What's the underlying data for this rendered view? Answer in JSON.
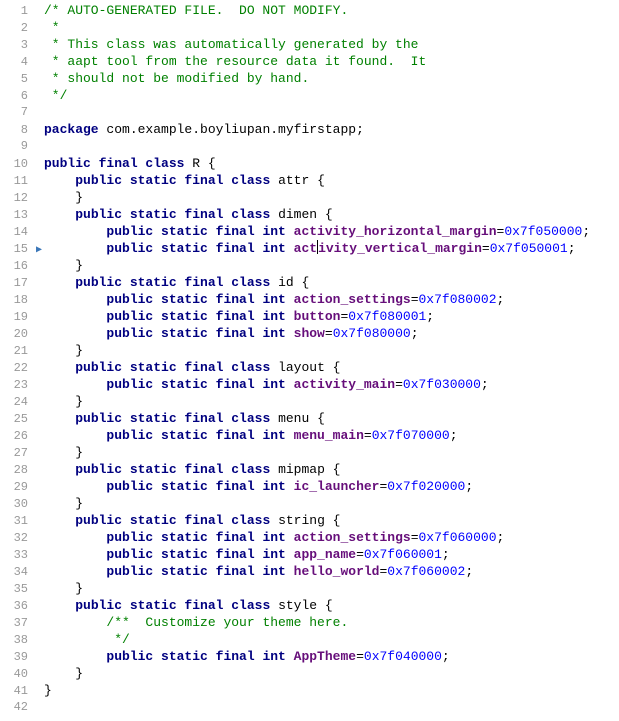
{
  "lines": [
    {
      "n": 1,
      "segs": [
        {
          "cls": "comment",
          "t": "/* AUTO-GENERATED FILE.  DO NOT MODIFY."
        }
      ]
    },
    {
      "n": 2,
      "segs": [
        {
          "cls": "comment",
          "t": " *"
        }
      ]
    },
    {
      "n": 3,
      "segs": [
        {
          "cls": "comment",
          "t": " * This class was automatically generated by the"
        }
      ]
    },
    {
      "n": 4,
      "segs": [
        {
          "cls": "comment",
          "t": " * aapt tool from the resource data it found.  It"
        }
      ]
    },
    {
      "n": 5,
      "segs": [
        {
          "cls": "comment",
          "t": " * should not be modified by hand."
        }
      ]
    },
    {
      "n": 6,
      "segs": [
        {
          "cls": "comment",
          "t": " */"
        }
      ]
    },
    {
      "n": 7,
      "segs": []
    },
    {
      "n": 8,
      "segs": [
        {
          "cls": "keyword",
          "t": "package "
        },
        {
          "cls": "identifier",
          "t": "com.example.boyliupan.myfirstapp"
        },
        {
          "cls": "punct",
          "t": ";"
        }
      ]
    },
    {
      "n": 9,
      "segs": []
    },
    {
      "n": 10,
      "segs": [
        {
          "cls": "keyword",
          "t": "public final class "
        },
        {
          "cls": "identifier",
          "t": "R "
        },
        {
          "cls": "punct",
          "t": "{"
        }
      ]
    },
    {
      "n": 11,
      "segs": [
        {
          "cls": "punct",
          "t": "    "
        },
        {
          "cls": "keyword",
          "t": "public static final class "
        },
        {
          "cls": "identifier",
          "t": "attr "
        },
        {
          "cls": "punct",
          "t": "{"
        }
      ]
    },
    {
      "n": 12,
      "segs": [
        {
          "cls": "punct",
          "t": "    }"
        }
      ]
    },
    {
      "n": 13,
      "segs": [
        {
          "cls": "punct",
          "t": "    "
        },
        {
          "cls": "keyword",
          "t": "public static final class "
        },
        {
          "cls": "identifier",
          "t": "dimen "
        },
        {
          "cls": "punct",
          "t": "{"
        }
      ]
    },
    {
      "n": 14,
      "segs": [
        {
          "cls": "punct",
          "t": "        "
        },
        {
          "cls": "keyword",
          "t": "public static final int "
        },
        {
          "cls": "field",
          "t": "activity_horizontal_margin"
        },
        {
          "cls": "punct",
          "t": "="
        },
        {
          "cls": "number",
          "t": "0x7f050000"
        },
        {
          "cls": "punct",
          "t": ";"
        }
      ]
    },
    {
      "n": 15,
      "marker": "▶",
      "segs": [
        {
          "cls": "punct",
          "t": "        "
        },
        {
          "cls": "keyword",
          "t": "public static final int "
        },
        {
          "cls": "field",
          "t": "act"
        },
        {
          "cls": "caret",
          "t": ""
        },
        {
          "cls": "field",
          "t": "ivity_vertical_margin"
        },
        {
          "cls": "punct",
          "t": "="
        },
        {
          "cls": "number",
          "t": "0x7f050001"
        },
        {
          "cls": "punct",
          "t": ";"
        }
      ]
    },
    {
      "n": 16,
      "segs": [
        {
          "cls": "punct",
          "t": "    }"
        }
      ]
    },
    {
      "n": 17,
      "segs": [
        {
          "cls": "punct",
          "t": "    "
        },
        {
          "cls": "keyword",
          "t": "public static final class "
        },
        {
          "cls": "identifier",
          "t": "id "
        },
        {
          "cls": "punct",
          "t": "{"
        }
      ]
    },
    {
      "n": 18,
      "segs": [
        {
          "cls": "punct",
          "t": "        "
        },
        {
          "cls": "keyword",
          "t": "public static final int "
        },
        {
          "cls": "field",
          "t": "action_settings"
        },
        {
          "cls": "punct",
          "t": "="
        },
        {
          "cls": "number",
          "t": "0x7f080002"
        },
        {
          "cls": "punct",
          "t": ";"
        }
      ]
    },
    {
      "n": 19,
      "segs": [
        {
          "cls": "punct",
          "t": "        "
        },
        {
          "cls": "keyword",
          "t": "public static final int "
        },
        {
          "cls": "field",
          "t": "button"
        },
        {
          "cls": "punct",
          "t": "="
        },
        {
          "cls": "number",
          "t": "0x7f080001"
        },
        {
          "cls": "punct",
          "t": ";"
        }
      ]
    },
    {
      "n": 20,
      "segs": [
        {
          "cls": "punct",
          "t": "        "
        },
        {
          "cls": "keyword",
          "t": "public static final int "
        },
        {
          "cls": "field",
          "t": "show"
        },
        {
          "cls": "punct",
          "t": "="
        },
        {
          "cls": "number",
          "t": "0x7f080000"
        },
        {
          "cls": "punct",
          "t": ";"
        }
      ]
    },
    {
      "n": 21,
      "segs": [
        {
          "cls": "punct",
          "t": "    }"
        }
      ]
    },
    {
      "n": 22,
      "segs": [
        {
          "cls": "punct",
          "t": "    "
        },
        {
          "cls": "keyword",
          "t": "public static final class "
        },
        {
          "cls": "identifier",
          "t": "layout "
        },
        {
          "cls": "punct",
          "t": "{"
        }
      ]
    },
    {
      "n": 23,
      "segs": [
        {
          "cls": "punct",
          "t": "        "
        },
        {
          "cls": "keyword",
          "t": "public static final int "
        },
        {
          "cls": "field",
          "t": "activity_main"
        },
        {
          "cls": "punct",
          "t": "="
        },
        {
          "cls": "number",
          "t": "0x7f030000"
        },
        {
          "cls": "punct",
          "t": ";"
        }
      ]
    },
    {
      "n": 24,
      "segs": [
        {
          "cls": "punct",
          "t": "    }"
        }
      ]
    },
    {
      "n": 25,
      "segs": [
        {
          "cls": "punct",
          "t": "    "
        },
        {
          "cls": "keyword",
          "t": "public static final class "
        },
        {
          "cls": "identifier",
          "t": "menu "
        },
        {
          "cls": "punct",
          "t": "{"
        }
      ]
    },
    {
      "n": 26,
      "segs": [
        {
          "cls": "punct",
          "t": "        "
        },
        {
          "cls": "keyword",
          "t": "public static final int "
        },
        {
          "cls": "field",
          "t": "menu_main"
        },
        {
          "cls": "punct",
          "t": "="
        },
        {
          "cls": "number",
          "t": "0x7f070000"
        },
        {
          "cls": "punct",
          "t": ";"
        }
      ]
    },
    {
      "n": 27,
      "segs": [
        {
          "cls": "punct",
          "t": "    }"
        }
      ]
    },
    {
      "n": 28,
      "segs": [
        {
          "cls": "punct",
          "t": "    "
        },
        {
          "cls": "keyword",
          "t": "public static final class "
        },
        {
          "cls": "identifier",
          "t": "mipmap "
        },
        {
          "cls": "punct",
          "t": "{"
        }
      ]
    },
    {
      "n": 29,
      "segs": [
        {
          "cls": "punct",
          "t": "        "
        },
        {
          "cls": "keyword",
          "t": "public static final int "
        },
        {
          "cls": "field",
          "t": "ic_launcher"
        },
        {
          "cls": "punct",
          "t": "="
        },
        {
          "cls": "number",
          "t": "0x7f020000"
        },
        {
          "cls": "punct",
          "t": ";"
        }
      ]
    },
    {
      "n": 30,
      "segs": [
        {
          "cls": "punct",
          "t": "    }"
        }
      ]
    },
    {
      "n": 31,
      "segs": [
        {
          "cls": "punct",
          "t": "    "
        },
        {
          "cls": "keyword",
          "t": "public static final class "
        },
        {
          "cls": "identifier",
          "t": "string "
        },
        {
          "cls": "punct",
          "t": "{"
        }
      ]
    },
    {
      "n": 32,
      "segs": [
        {
          "cls": "punct",
          "t": "        "
        },
        {
          "cls": "keyword",
          "t": "public static final int "
        },
        {
          "cls": "field",
          "t": "action_settings"
        },
        {
          "cls": "punct",
          "t": "="
        },
        {
          "cls": "number",
          "t": "0x7f060000"
        },
        {
          "cls": "punct",
          "t": ";"
        }
      ]
    },
    {
      "n": 33,
      "segs": [
        {
          "cls": "punct",
          "t": "        "
        },
        {
          "cls": "keyword",
          "t": "public static final int "
        },
        {
          "cls": "field",
          "t": "app_name"
        },
        {
          "cls": "punct",
          "t": "="
        },
        {
          "cls": "number",
          "t": "0x7f060001"
        },
        {
          "cls": "punct",
          "t": ";"
        }
      ]
    },
    {
      "n": 34,
      "segs": [
        {
          "cls": "punct",
          "t": "        "
        },
        {
          "cls": "keyword",
          "t": "public static final int "
        },
        {
          "cls": "field",
          "t": "hello_world"
        },
        {
          "cls": "punct",
          "t": "="
        },
        {
          "cls": "number",
          "t": "0x7f060002"
        },
        {
          "cls": "punct",
          "t": ";"
        }
      ]
    },
    {
      "n": 35,
      "segs": [
        {
          "cls": "punct",
          "t": "    }"
        }
      ]
    },
    {
      "n": 36,
      "segs": [
        {
          "cls": "punct",
          "t": "    "
        },
        {
          "cls": "keyword",
          "t": "public static final class "
        },
        {
          "cls": "identifier",
          "t": "style "
        },
        {
          "cls": "punct",
          "t": "{"
        }
      ]
    },
    {
      "n": 37,
      "segs": [
        {
          "cls": "punct",
          "t": "        "
        },
        {
          "cls": "comment",
          "t": "/**  Customize your theme here."
        }
      ]
    },
    {
      "n": 38,
      "segs": [
        {
          "cls": "punct",
          "t": "         "
        },
        {
          "cls": "comment",
          "t": "*/"
        }
      ]
    },
    {
      "n": 39,
      "segs": [
        {
          "cls": "punct",
          "t": "        "
        },
        {
          "cls": "keyword",
          "t": "public static final int "
        },
        {
          "cls": "field",
          "t": "AppTheme"
        },
        {
          "cls": "punct",
          "t": "="
        },
        {
          "cls": "number",
          "t": "0x7f040000"
        },
        {
          "cls": "punct",
          "t": ";"
        }
      ]
    },
    {
      "n": 40,
      "segs": [
        {
          "cls": "punct",
          "t": "    }"
        }
      ]
    },
    {
      "n": 41,
      "segs": [
        {
          "cls": "punct",
          "t": "}"
        }
      ]
    },
    {
      "n": 42,
      "segs": []
    }
  ]
}
